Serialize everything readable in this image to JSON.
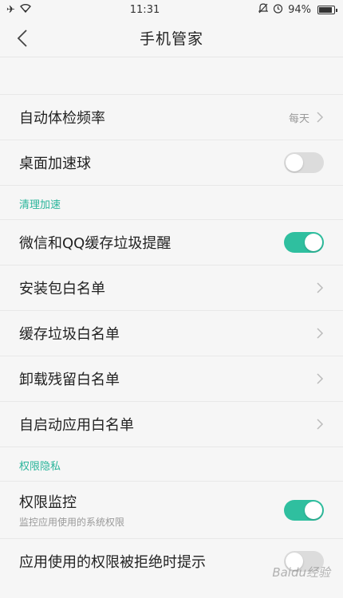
{
  "status_bar": {
    "time": "11:31",
    "battery_text": "94%",
    "battery_level": 0.94,
    "left_icons": [
      "airplane-icon",
      "wifi-icon"
    ],
    "right_icons": [
      "mute-icon",
      "alarm-icon"
    ]
  },
  "header": {
    "title": "手机管家"
  },
  "rows": {
    "check_frequency": {
      "label": "自动体检频率",
      "value": "每天"
    },
    "desktop_ball": {
      "label": "桌面加速球",
      "toggle": false
    }
  },
  "section_clean": {
    "header": "清理加速",
    "wechat_qq": {
      "label": "微信和QQ缓存垃圾提醒",
      "toggle": true
    },
    "apk_whitelist": {
      "label": "安装包白名单"
    },
    "cache_whitelist": {
      "label": "缓存垃圾白名单"
    },
    "residual_whitelist": {
      "label": "卸载残留白名单"
    },
    "autostart_whitelist": {
      "label": "自启动应用白名单"
    }
  },
  "section_privacy": {
    "header": "权限隐私",
    "permission_monitor": {
      "label": "权限监控",
      "sub": "监控应用使用的系统权限",
      "toggle": true
    },
    "denied_prompt": {
      "label": "应用使用的权限被拒绝时提示",
      "toggle": false
    }
  },
  "watermark": "Baidu经验",
  "colors": {
    "accent": "#2fbf9f",
    "section_text": "#2ab59b",
    "toggle_off": "#dcdcdc"
  }
}
